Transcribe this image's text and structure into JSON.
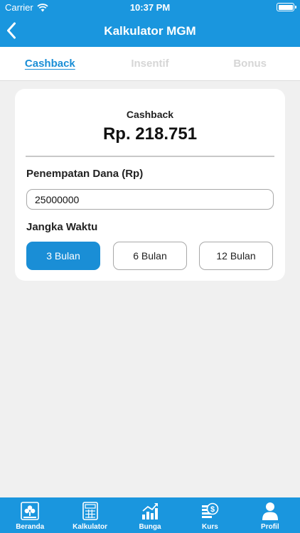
{
  "status_bar": {
    "carrier": "Carrier",
    "time": "10:37 PM"
  },
  "nav": {
    "title": "Kalkulator MGM"
  },
  "tabs": [
    {
      "label": "Cashback",
      "active": true
    },
    {
      "label": "Insentif",
      "active": false
    },
    {
      "label": "Bonus",
      "active": false
    }
  ],
  "card": {
    "cashback_label": "Cashback",
    "cashback_amount": "Rp. 218.751",
    "placement_label": "Penempatan Dana (Rp)",
    "placement_value": "25000000",
    "term_label": "Jangka Waktu",
    "terms": [
      {
        "label": "3 Bulan",
        "selected": true
      },
      {
        "label": "6 Bulan",
        "selected": false
      },
      {
        "label": "12 Bulan",
        "selected": false
      }
    ]
  },
  "bottom_nav": [
    {
      "label": "Beranda",
      "icon": "home-logo-icon"
    },
    {
      "label": "Kalkulator",
      "icon": "calculator-icon"
    },
    {
      "label": "Bunga",
      "icon": "chart-icon"
    },
    {
      "label": "Kurs",
      "icon": "money-icon"
    },
    {
      "label": "Profil",
      "icon": "profile-icon"
    }
  ],
  "colors": {
    "primary": "#1a96de",
    "accent": "#1a8ed6",
    "background": "#f0f0f0"
  }
}
